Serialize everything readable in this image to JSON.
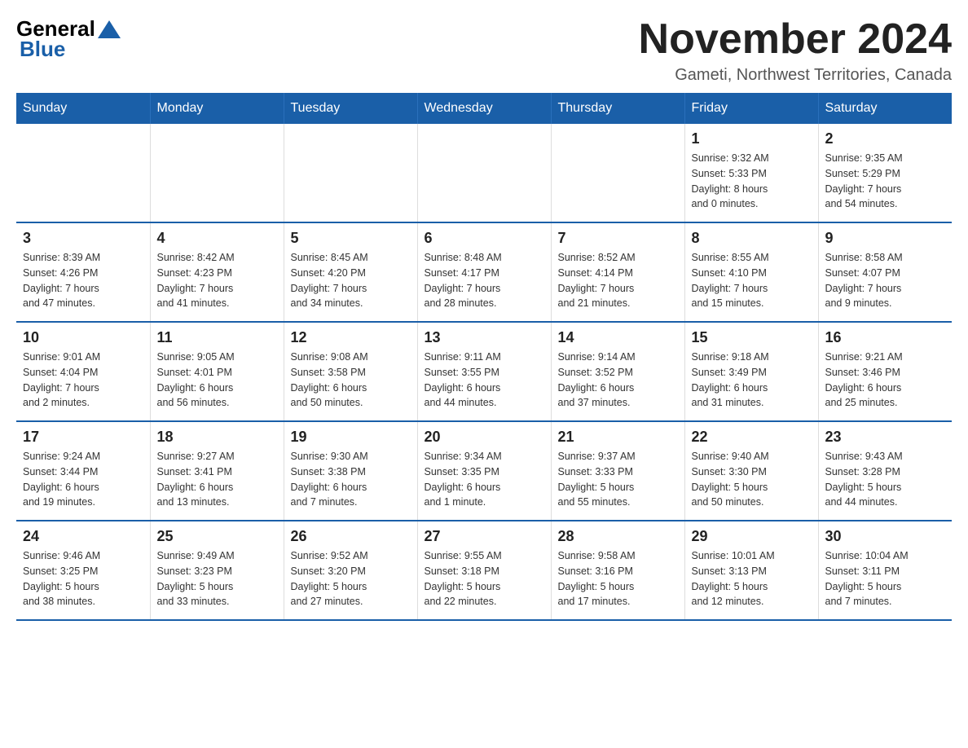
{
  "header": {
    "logo_general": "General",
    "logo_blue": "Blue",
    "title": "November 2024",
    "subtitle": "Gameti, Northwest Territories, Canada"
  },
  "calendar": {
    "days": [
      "Sunday",
      "Monday",
      "Tuesday",
      "Wednesday",
      "Thursday",
      "Friday",
      "Saturday"
    ],
    "weeks": [
      [
        {
          "day": "",
          "info": ""
        },
        {
          "day": "",
          "info": ""
        },
        {
          "day": "",
          "info": ""
        },
        {
          "day": "",
          "info": ""
        },
        {
          "day": "",
          "info": ""
        },
        {
          "day": "1",
          "info": "Sunrise: 9:32 AM\nSunset: 5:33 PM\nDaylight: 8 hours\nand 0 minutes."
        },
        {
          "day": "2",
          "info": "Sunrise: 9:35 AM\nSunset: 5:29 PM\nDaylight: 7 hours\nand 54 minutes."
        }
      ],
      [
        {
          "day": "3",
          "info": "Sunrise: 8:39 AM\nSunset: 4:26 PM\nDaylight: 7 hours\nand 47 minutes."
        },
        {
          "day": "4",
          "info": "Sunrise: 8:42 AM\nSunset: 4:23 PM\nDaylight: 7 hours\nand 41 minutes."
        },
        {
          "day": "5",
          "info": "Sunrise: 8:45 AM\nSunset: 4:20 PM\nDaylight: 7 hours\nand 34 minutes."
        },
        {
          "day": "6",
          "info": "Sunrise: 8:48 AM\nSunset: 4:17 PM\nDaylight: 7 hours\nand 28 minutes."
        },
        {
          "day": "7",
          "info": "Sunrise: 8:52 AM\nSunset: 4:14 PM\nDaylight: 7 hours\nand 21 minutes."
        },
        {
          "day": "8",
          "info": "Sunrise: 8:55 AM\nSunset: 4:10 PM\nDaylight: 7 hours\nand 15 minutes."
        },
        {
          "day": "9",
          "info": "Sunrise: 8:58 AM\nSunset: 4:07 PM\nDaylight: 7 hours\nand 9 minutes."
        }
      ],
      [
        {
          "day": "10",
          "info": "Sunrise: 9:01 AM\nSunset: 4:04 PM\nDaylight: 7 hours\nand 2 minutes."
        },
        {
          "day": "11",
          "info": "Sunrise: 9:05 AM\nSunset: 4:01 PM\nDaylight: 6 hours\nand 56 minutes."
        },
        {
          "day": "12",
          "info": "Sunrise: 9:08 AM\nSunset: 3:58 PM\nDaylight: 6 hours\nand 50 minutes."
        },
        {
          "day": "13",
          "info": "Sunrise: 9:11 AM\nSunset: 3:55 PM\nDaylight: 6 hours\nand 44 minutes."
        },
        {
          "day": "14",
          "info": "Sunrise: 9:14 AM\nSunset: 3:52 PM\nDaylight: 6 hours\nand 37 minutes."
        },
        {
          "day": "15",
          "info": "Sunrise: 9:18 AM\nSunset: 3:49 PM\nDaylight: 6 hours\nand 31 minutes."
        },
        {
          "day": "16",
          "info": "Sunrise: 9:21 AM\nSunset: 3:46 PM\nDaylight: 6 hours\nand 25 minutes."
        }
      ],
      [
        {
          "day": "17",
          "info": "Sunrise: 9:24 AM\nSunset: 3:44 PM\nDaylight: 6 hours\nand 19 minutes."
        },
        {
          "day": "18",
          "info": "Sunrise: 9:27 AM\nSunset: 3:41 PM\nDaylight: 6 hours\nand 13 minutes."
        },
        {
          "day": "19",
          "info": "Sunrise: 9:30 AM\nSunset: 3:38 PM\nDaylight: 6 hours\nand 7 minutes."
        },
        {
          "day": "20",
          "info": "Sunrise: 9:34 AM\nSunset: 3:35 PM\nDaylight: 6 hours\nand 1 minute."
        },
        {
          "day": "21",
          "info": "Sunrise: 9:37 AM\nSunset: 3:33 PM\nDaylight: 5 hours\nand 55 minutes."
        },
        {
          "day": "22",
          "info": "Sunrise: 9:40 AM\nSunset: 3:30 PM\nDaylight: 5 hours\nand 50 minutes."
        },
        {
          "day": "23",
          "info": "Sunrise: 9:43 AM\nSunset: 3:28 PM\nDaylight: 5 hours\nand 44 minutes."
        }
      ],
      [
        {
          "day": "24",
          "info": "Sunrise: 9:46 AM\nSunset: 3:25 PM\nDaylight: 5 hours\nand 38 minutes."
        },
        {
          "day": "25",
          "info": "Sunrise: 9:49 AM\nSunset: 3:23 PM\nDaylight: 5 hours\nand 33 minutes."
        },
        {
          "day": "26",
          "info": "Sunrise: 9:52 AM\nSunset: 3:20 PM\nDaylight: 5 hours\nand 27 minutes."
        },
        {
          "day": "27",
          "info": "Sunrise: 9:55 AM\nSunset: 3:18 PM\nDaylight: 5 hours\nand 22 minutes."
        },
        {
          "day": "28",
          "info": "Sunrise: 9:58 AM\nSunset: 3:16 PM\nDaylight: 5 hours\nand 17 minutes."
        },
        {
          "day": "29",
          "info": "Sunrise: 10:01 AM\nSunset: 3:13 PM\nDaylight: 5 hours\nand 12 minutes."
        },
        {
          "day": "30",
          "info": "Sunrise: 10:04 AM\nSunset: 3:11 PM\nDaylight: 5 hours\nand 7 minutes."
        }
      ]
    ]
  }
}
